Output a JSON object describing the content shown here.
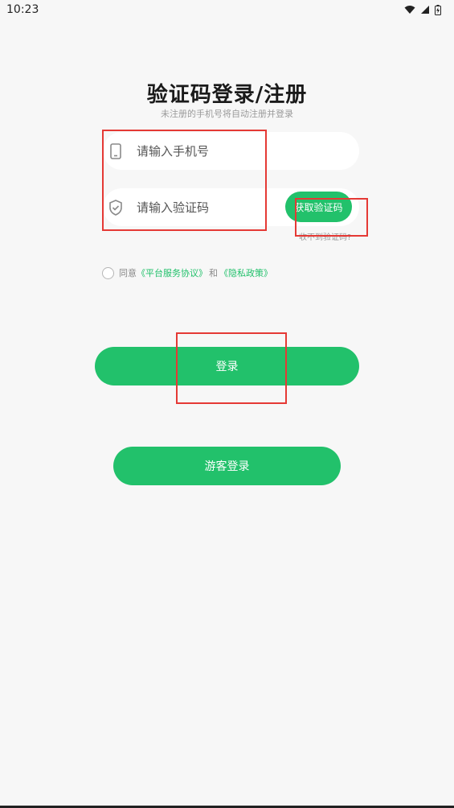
{
  "status_bar": {
    "time": "10:23",
    "icons": [
      "wifi-icon",
      "signal-icon",
      "battery-icon"
    ]
  },
  "header": {
    "title": "验证码登录/注册",
    "subtitle": "未注册的手机号将自动注册并登录"
  },
  "form": {
    "phone_placeholder": "请输入手机号",
    "code_placeholder": "请输入验证码",
    "get_code_label": "获取验证码",
    "no_code_link": "收不到验证码?"
  },
  "agreement": {
    "prefix": "同意",
    "service_link": "《平台服务协议》",
    "and": "和",
    "privacy_link": "《隐私政策》",
    "checked": false
  },
  "actions": {
    "login_label": "登录",
    "guest_label": "游客登录"
  },
  "colors": {
    "accent": "#22c16b",
    "annotation": "#e53935",
    "background": "#f7f7f7"
  }
}
